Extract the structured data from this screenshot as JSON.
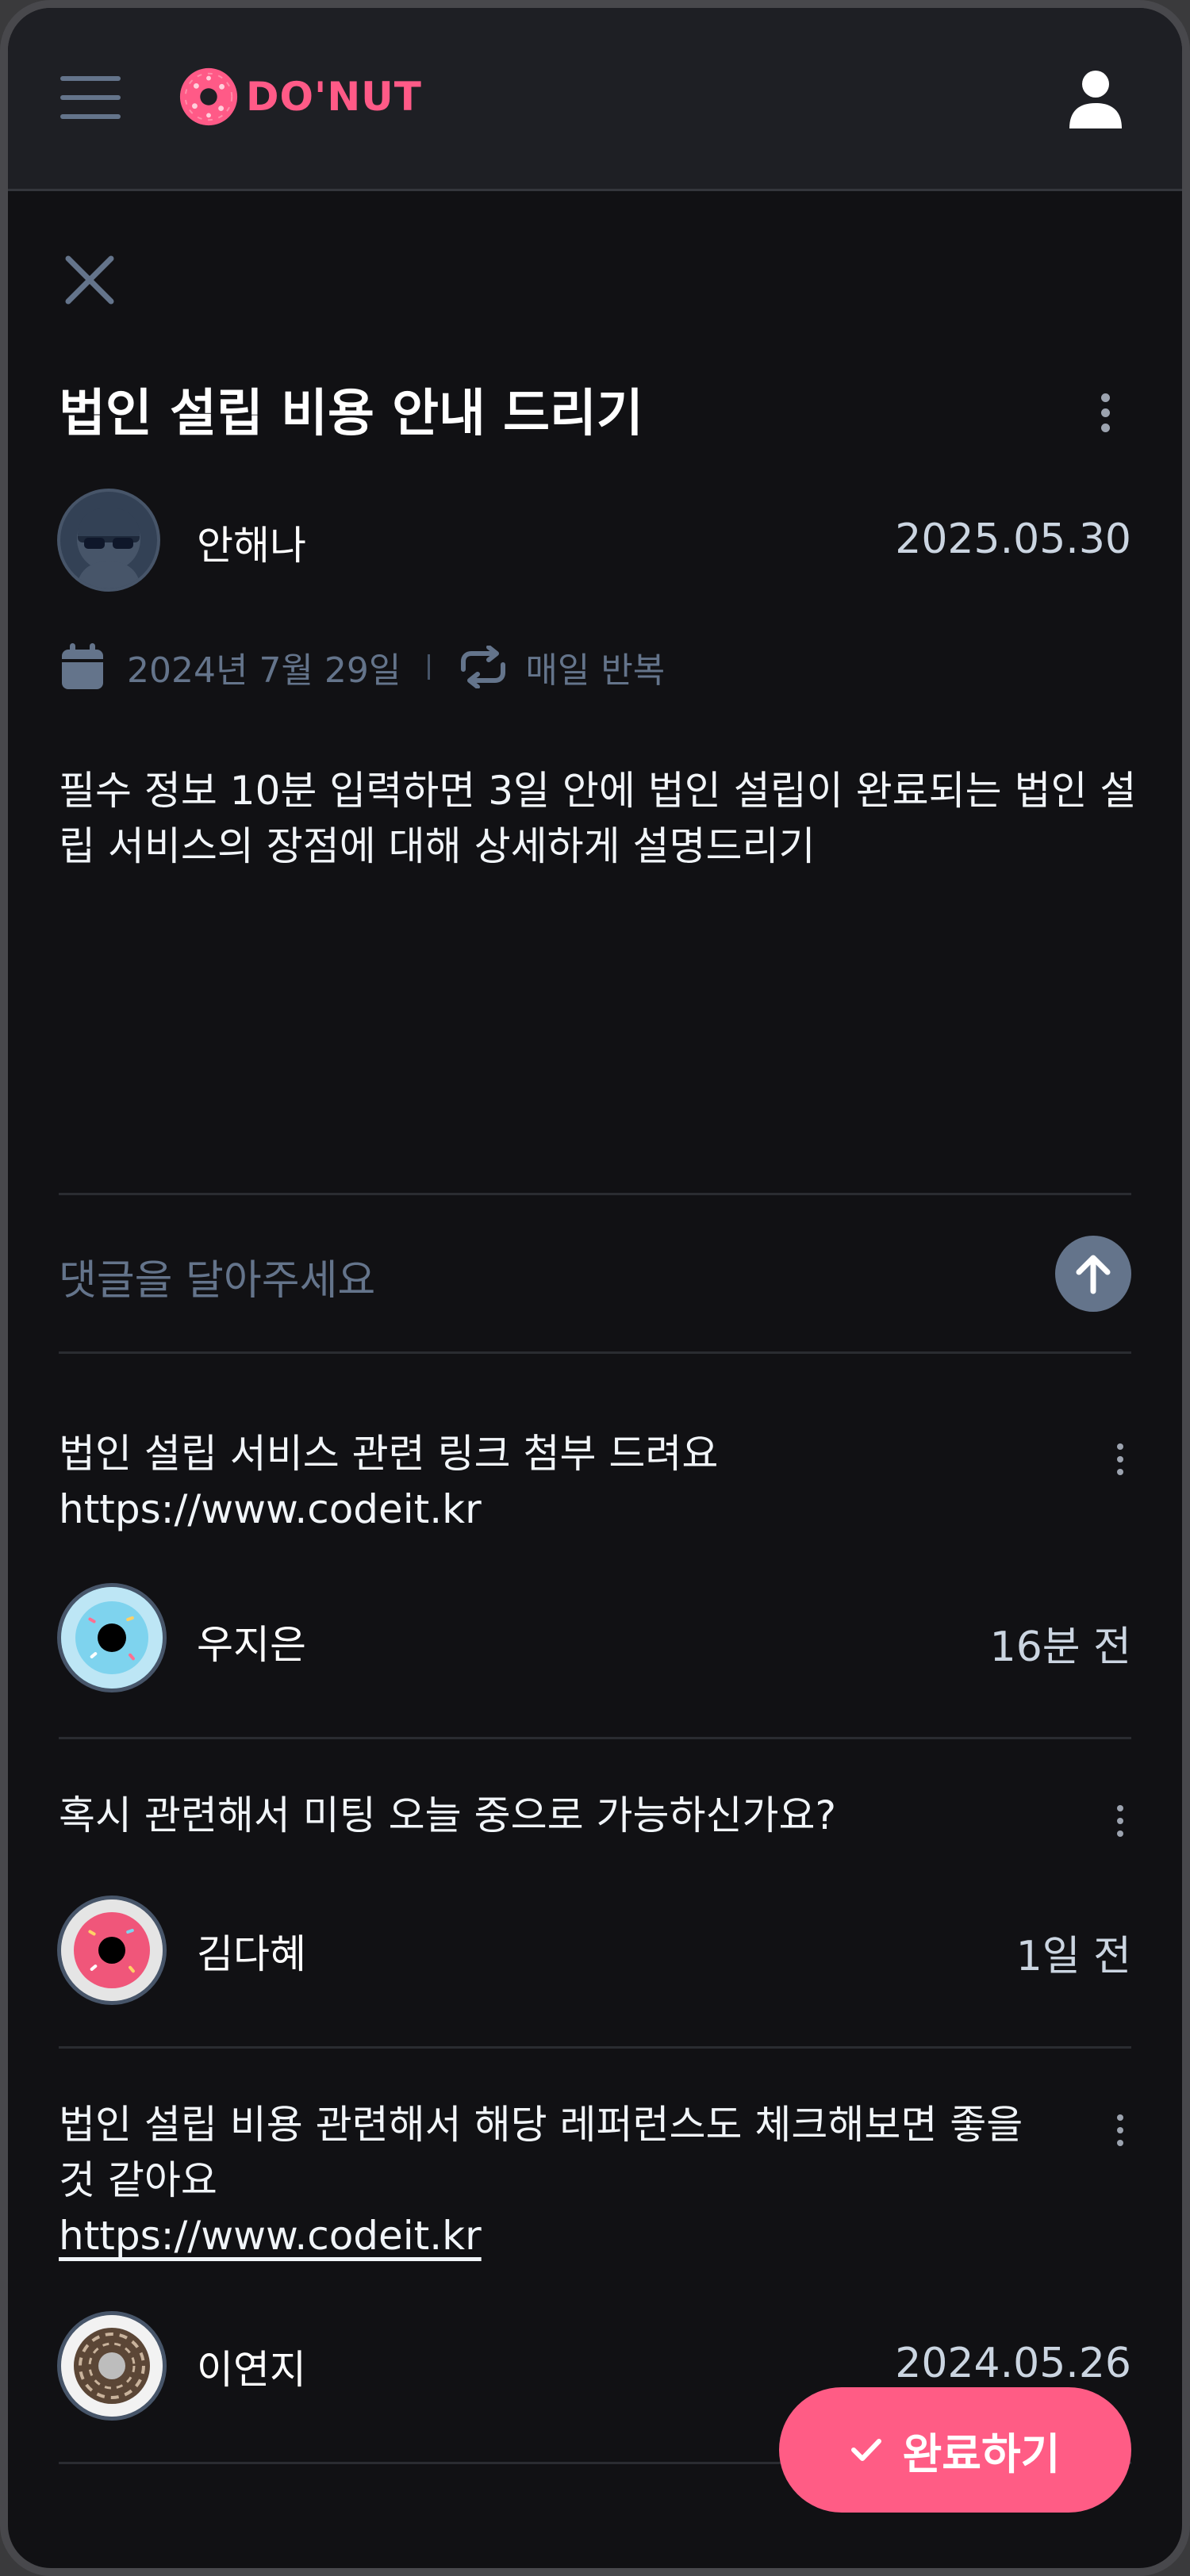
{
  "header": {
    "logo_text": "DO'NUT",
    "menu_icon": "hamburger-menu-icon",
    "user_icon": "user-icon",
    "brand_color": "#ff5a87"
  },
  "task": {
    "close_icon": "close-icon",
    "title": "법인 설립 비용 안내 드리기",
    "menu_icon": "kebab-menu-icon",
    "author": {
      "name": "안해나",
      "date": "2025.05.30",
      "avatar_icon": "avatar-icon"
    },
    "meta": {
      "calendar_icon": "calendar-icon",
      "date": "2024년 7월 29일",
      "repeat_icon": "repeat-icon",
      "repeat": "매일 반복"
    },
    "description": "필수 정보 10분 입력하면 3일 안에 법인 설립이 완료되는 법인 설립 서비스의 장점에 대해 상세하게 설명드리기"
  },
  "comment_input": {
    "placeholder": "댓글을 달아주세요",
    "send_icon": "arrow-up-icon"
  },
  "comments": [
    {
      "text": "법인 설립 서비스 관련 링크 첨부 드려요",
      "link": "https://www.codeit.kr",
      "author": "우지은",
      "time": "16분 전"
    },
    {
      "text": "혹시 관련해서 미팅 오늘 중으로 가능하신가요?",
      "author": "김다혜",
      "time": "1일 전"
    },
    {
      "text": "법인 설립 비용 관련해서 해당 레퍼런스도 체크해보면 좋을 것 같아요",
      "link": "https://www.codeit.kr",
      "author": "이연지",
      "time": "2024.05.26"
    }
  ],
  "complete_button": {
    "label": "완료하기",
    "icon": "check-icon",
    "color": "#ff5c85"
  }
}
